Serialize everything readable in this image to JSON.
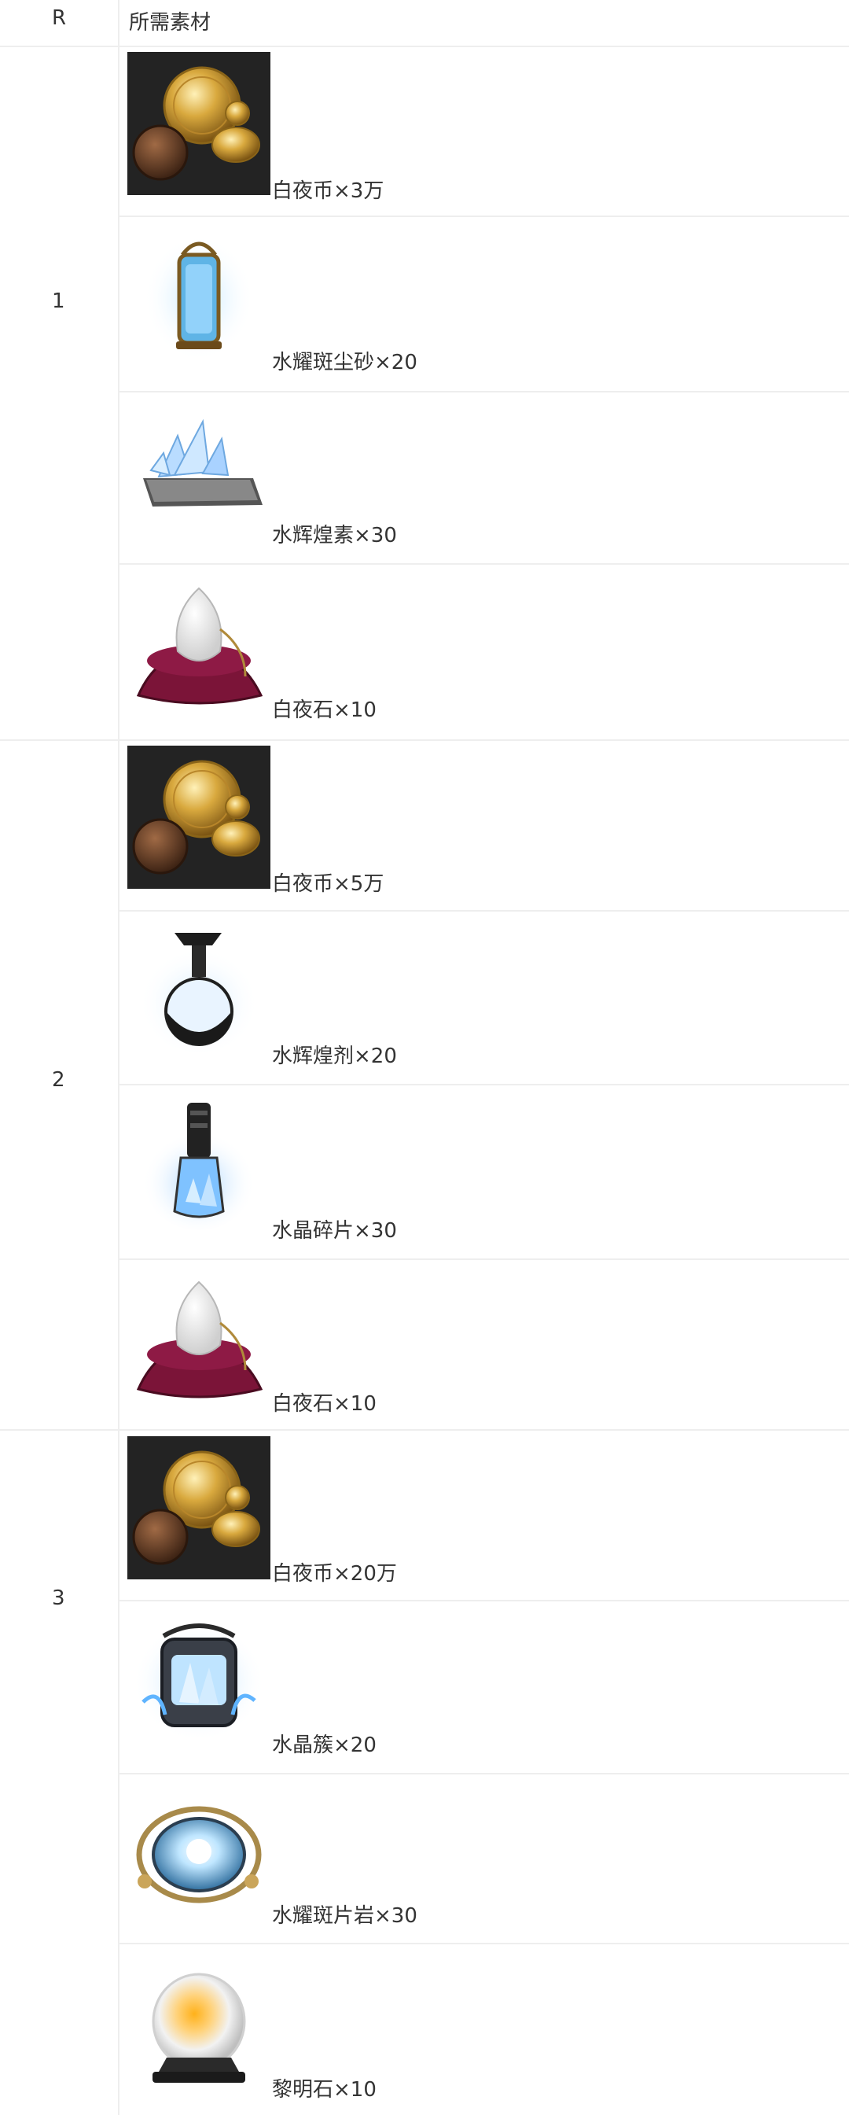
{
  "header": {
    "rank": "R",
    "materials": "所需素材"
  },
  "groups": [
    {
      "rank": "1",
      "items": [
        {
          "name": "白夜币×3万",
          "icon": "coins-icon"
        },
        {
          "name": "水耀斑尘砂×20",
          "icon": "lantern-icon"
        },
        {
          "name": "水辉煌素×30",
          "icon": "crystal-shard-icon"
        },
        {
          "name": "白夜石×10",
          "icon": "white-stone-icon"
        }
      ]
    },
    {
      "rank": "2",
      "items": [
        {
          "name": "白夜币×5万",
          "icon": "coins-icon"
        },
        {
          "name": "水辉煌剂×20",
          "icon": "potion-flask-icon"
        },
        {
          "name": "水晶碎片×30",
          "icon": "crystal-vial-icon"
        },
        {
          "name": "白夜石×10",
          "icon": "white-stone-icon"
        }
      ]
    },
    {
      "rank": "3",
      "items": [
        {
          "name": "白夜币×20万",
          "icon": "coins-icon"
        },
        {
          "name": "水晶簇×20",
          "icon": "crystal-cluster-icon"
        },
        {
          "name": "水耀斑片岩×30",
          "icon": "crystal-orb-icon"
        },
        {
          "name": "黎明石×10",
          "icon": "dawn-stone-icon"
        }
      ]
    }
  ]
}
